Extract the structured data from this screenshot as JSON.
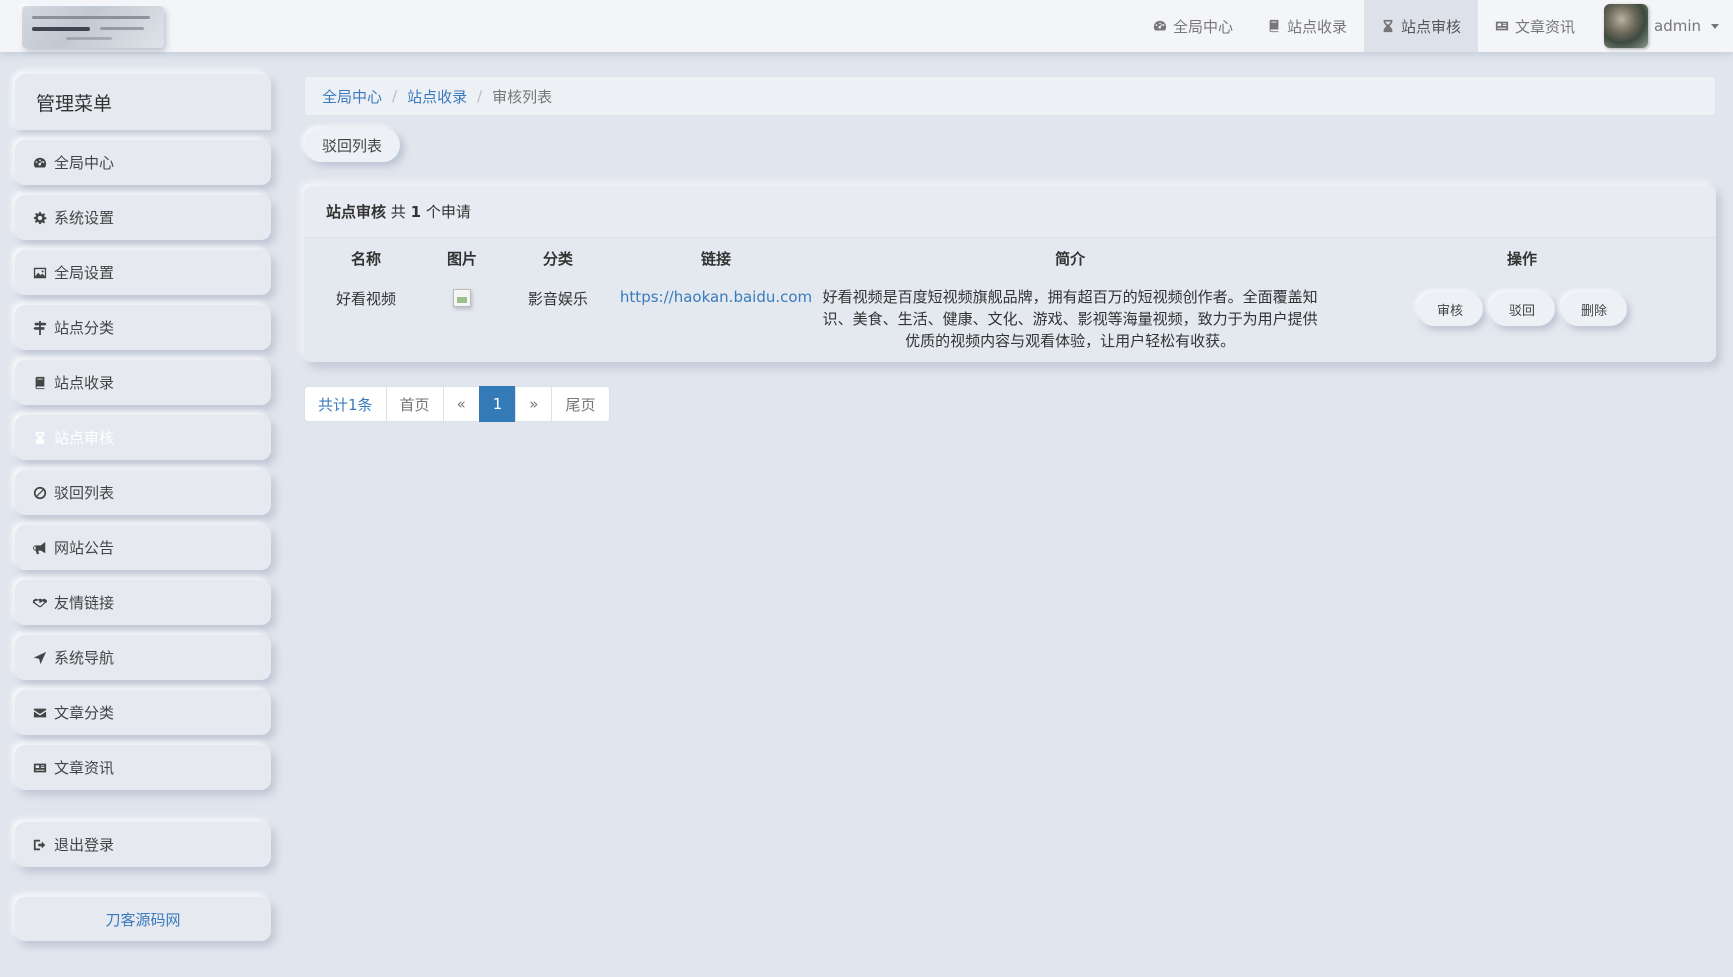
{
  "navbar": {
    "items": [
      {
        "label": "全局中心",
        "icon": "dashboard-icon"
      },
      {
        "label": "站点收录",
        "icon": "book-icon"
      },
      {
        "label": "站点审核",
        "icon": "hourglass-icon",
        "active": true
      },
      {
        "label": "文章资讯",
        "icon": "newspaper-icon"
      }
    ],
    "user": "admin"
  },
  "sidebar": {
    "title": "管理菜单",
    "items": [
      {
        "label": "全局中心",
        "icon": "dashboard-icon"
      },
      {
        "label": "系统设置",
        "icon": "gear-icon"
      },
      {
        "label": "全局设置",
        "icon": "image-icon"
      },
      {
        "label": "站点分类",
        "icon": "signpost-icon"
      },
      {
        "label": "站点收录",
        "icon": "book-icon"
      },
      {
        "label": "站点审核",
        "icon": "hourglass-icon",
        "active": true
      },
      {
        "label": "驳回列表",
        "icon": "ban-icon"
      },
      {
        "label": "网站公告",
        "icon": "bullhorn-icon"
      },
      {
        "label": "友情链接",
        "icon": "handshake-icon"
      },
      {
        "label": "系统导航",
        "icon": "location-arrow-icon"
      },
      {
        "label": "文章分类",
        "icon": "envelope-icon"
      },
      {
        "label": "文章资讯",
        "icon": "newspaper-icon"
      }
    ],
    "logout": "退出登录",
    "footer": "刀客源码网"
  },
  "breadcrumb": {
    "home": "全局中心",
    "parent": "站点收录",
    "current": "审核列表",
    "separator": "/"
  },
  "reject_button": "驳回列表",
  "panel": {
    "title": "站点审核",
    "count_prefix": "共",
    "count": "1",
    "count_suffix": "个申请",
    "columns": [
      "名称",
      "图片",
      "分类",
      "链接",
      "简介",
      "操作"
    ],
    "rows": [
      {
        "name": "好看视频",
        "category": "影音娱乐",
        "link": "https://haokan.baidu.com",
        "intro": "好看视频是百度短视频旗舰品牌，拥有超百万的短视频创作者。全面覆盖知识、美食、生活、健康、文化、游戏、影视等海量视频，致力于为用户提供优质的视频内容与观看体验，让用户轻松有收获。",
        "actions": [
          "审核",
          "驳回",
          "删除"
        ]
      }
    ]
  },
  "pagination": {
    "total": "共计1条",
    "first": "首页",
    "prev": "«",
    "current": "1",
    "next": "»",
    "last": "尾页"
  },
  "colors": {
    "background": "#e1e6ee",
    "link": "#3a7bbd",
    "pager_active": "#337ab7"
  }
}
